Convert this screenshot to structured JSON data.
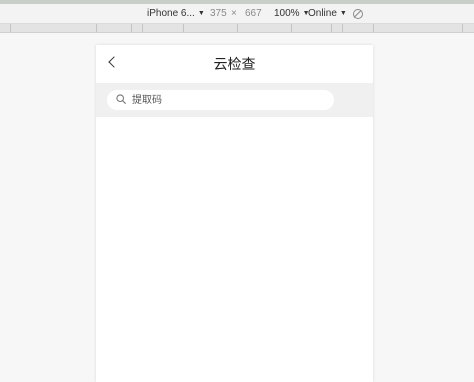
{
  "devtools": {
    "device_name": "iPhone 6...",
    "width": "375",
    "times": "×",
    "height": "667",
    "zoom": "100%",
    "network": "Online",
    "throttle_icon": "throttle-icon"
  },
  "app": {
    "title": "云检查",
    "back_icon": "chevron-left-icon",
    "search": {
      "placeholder": "提取码",
      "value": "",
      "icon": "search-icon"
    }
  },
  "colors": {
    "page_bg": "#f7f7f7",
    "device_bg": "#ffffff",
    "search_bar_bg": "#f0f0f0",
    "title_text": "#222222"
  }
}
